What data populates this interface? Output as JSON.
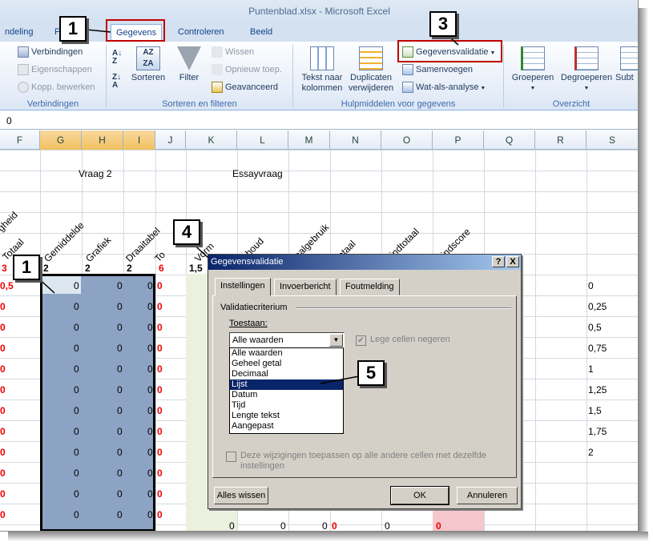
{
  "window": {
    "title": "Puntenblad.xlsx  -  Microsoft Excel"
  },
  "ribbon_tabs": {
    "t1": "ndeling",
    "t2": "F",
    "t3": "Gegevens",
    "t4": "Controleren",
    "t5": "Beeld"
  },
  "ribbon": {
    "conn": {
      "connections": "Verbindingen",
      "properties": "Eigenschappen",
      "edit_links": "Kopp. bewerken",
      "group": "Verbindingen"
    },
    "sort": {
      "sort": "Sorteren",
      "filter": "Filter",
      "clear": "Wissen",
      "reapply": "Opnieuw toep.",
      "advanced": "Geavanceerd",
      "group": "Sorteren en filteren"
    },
    "tools": {
      "text_cols_1": "Tekst naar",
      "text_cols_2": "kolommen",
      "dups_1": "Duplicaten",
      "dups_2": "verwijderen",
      "validation": "Gegevensvalidatie",
      "consolidate": "Samenvoegen",
      "whatif": "Wat-als-analyse",
      "group": "Hulpmiddelen voor gegevens"
    },
    "outline": {
      "group_btn": "Groeperen",
      "ungroup": "Degroeperen",
      "subtotal": "Subt",
      "group": "Overzicht"
    }
  },
  "formula_bar": {
    "value": "0"
  },
  "columns": [
    "F",
    "G",
    "H",
    "I",
    "J",
    "K",
    "L",
    "M",
    "N",
    "O",
    "P",
    "Q",
    "R",
    "S"
  ],
  "sheet": {
    "q2": "Vraag 2",
    "essay": "Essayvraag",
    "h_heid": "gheid",
    "h_totaal": "Totaal",
    "h_gemiddelde": "Gemiddelde",
    "h_grafiek": "Grafiek",
    "h_draaitabel": "Draaitabel",
    "h_to": "To",
    "h_vorm": "Vorm",
    "h_inhoud": "Inhoud",
    "h_taal": "Taalgebruik",
    "h_totaal2": "Totaal",
    "h_eindtotaal": "Eindtotaal",
    "h_eindscore": "Eindscore",
    "row3_f": "3",
    "row3_g": "2",
    "row3_h": "2",
    "row3_i": "2",
    "row3_j": "6",
    "row3_k": "1,5",
    "f_col": [
      "0,5",
      "0",
      "0",
      "0",
      "0",
      "0",
      "0",
      "0",
      "0",
      "0",
      "0",
      "0"
    ],
    "zero": "0",
    "s_col": [
      "0",
      "0,25",
      "0,5",
      "0,75",
      "1",
      "1,25",
      "1,5",
      "1,75",
      "2"
    ]
  },
  "callouts": {
    "c1": "1",
    "c2": "3",
    "c3": "4",
    "c4": "1",
    "c5": "5"
  },
  "dialog": {
    "title": "Gegevensvalidatie",
    "help": "?",
    "close": "X",
    "tabs": [
      "Instellingen",
      "Invoerbericht",
      "Foutmelding"
    ],
    "section": "Validatiecriterium",
    "allow_label": "Toestaan:",
    "allow_value": "Alle waarden",
    "ignore_blank": "Lege cellen negeren",
    "options": [
      "Alle waarden",
      "Geheel getal",
      "Decimaal",
      "Lijst",
      "Datum",
      "Tijd",
      "Lengte tekst",
      "Aangepast"
    ],
    "selected_option": "Lijst",
    "apply_all_1": "Deze wijzigingen toepassen op alle andere cellen met dezelfde",
    "apply_all_2": "instellingen",
    "clear_all": "Alles wissen",
    "ok": "OK",
    "cancel": "Annuleren"
  },
  "colors": {
    "accent": "#15428b",
    "selection": "#8da3c4",
    "callout_border": "#c00000",
    "highlight": "#0a246a"
  }
}
